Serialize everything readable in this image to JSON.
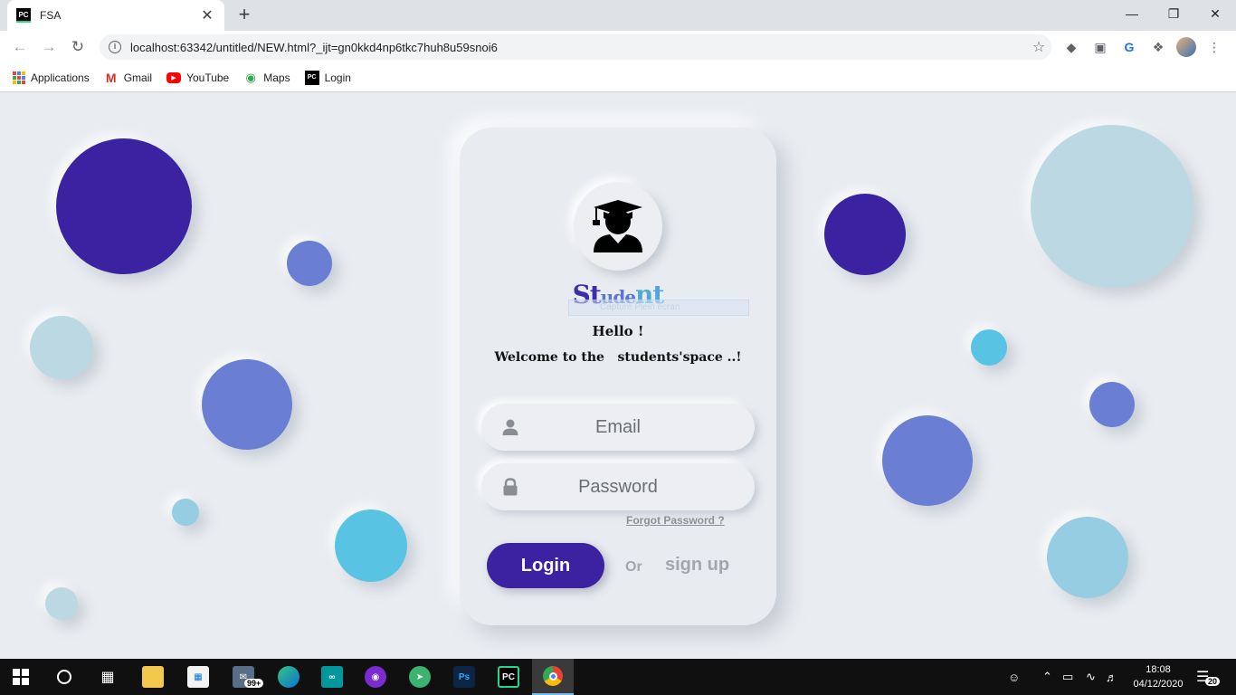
{
  "browser": {
    "tab_title": "FSA",
    "tab_favicon": "PC",
    "url": "localhost:63342/untitled/NEW.html?_ijt=gn0kkd4np6tkc7huh8u59snoi6",
    "bookmarks": [
      {
        "label": "Applications",
        "icon": "apps-grid-icon"
      },
      {
        "label": "Gmail",
        "icon": "gmail-icon"
      },
      {
        "label": "YouTube",
        "icon": "youtube-icon"
      },
      {
        "label": "Maps",
        "icon": "maps-icon"
      },
      {
        "label": "Login",
        "icon": "pycharm-icon"
      }
    ]
  },
  "card": {
    "brand_part1": "St",
    "brand_part2": "ude",
    "brand_part3": "nt",
    "capture_overlay": "Capture Plein écran",
    "greeting": "Hello !",
    "welcome": "Welcome to the   students'space ..!",
    "email_placeholder": "Email",
    "password_placeholder": "Password",
    "forgot": "Forgot Password ?",
    "login_label": "Login",
    "or_label": "Or",
    "signup_label": "sign up"
  },
  "colors": {
    "primary": "#3b22a0",
    "page_bg": "#e9ecf0",
    "bubble_dark": "#3b22a0",
    "bubble_mid": "#6a7fd3",
    "bubble_light": "#bcd9e3",
    "bubble_cyan": "#58c3e3"
  },
  "taskbar": {
    "mail_badge": "99+",
    "time": "18:08",
    "date": "04/12/2020",
    "notifications": "20"
  }
}
